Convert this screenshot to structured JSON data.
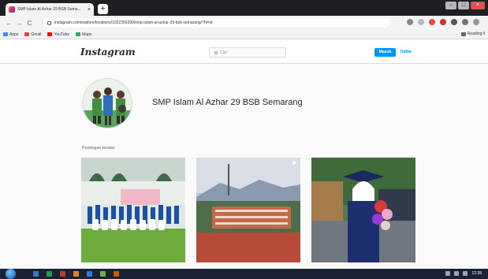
{
  "browser": {
    "tab_title": "SMP Islam Al Azhar 29 BSB Sema...",
    "tab_close": "×",
    "new_tab": "+",
    "url": "instagram.com/explore/locations/1022356390/smp-islam-al-azhar-29-bsb-semarang/?hl=id",
    "nav": {
      "back": "←",
      "forward": "→",
      "reload": "C"
    },
    "bookmarks": [
      {
        "label": "Apps",
        "color": "#4285f4"
      },
      {
        "label": "Gmail",
        "color": "#ea4335"
      },
      {
        "label": "YouTube",
        "color": "#ff0000"
      },
      {
        "label": "Maps",
        "color": "#34a853"
      }
    ],
    "reading_list": "Reading li",
    "window_controls": {
      "minimize": "–",
      "maximize": "□",
      "close": "×"
    }
  },
  "instagram": {
    "logo": "Instagram",
    "search_placeholder": "Cari",
    "login_label": "Masuk",
    "signup_label": "Daftar"
  },
  "profile": {
    "name": "SMP Islam Al Azhar 29 BSB Semarang"
  },
  "section": {
    "title": "Postingan teratas"
  },
  "posts": [
    {
      "description": "graduation group photo",
      "multi": false
    },
    {
      "description": "school building and mountain",
      "multi": true
    },
    {
      "description": "student with balloons in graduation gown",
      "multi": false
    }
  ],
  "taskbar": {
    "clock": "12:38",
    "icon_colors": [
      "#3b78c4",
      "#1e9e5a",
      "#c0392b",
      "#e67e22",
      "#2c7be5",
      "#6ab04c",
      "#d35400"
    ]
  }
}
